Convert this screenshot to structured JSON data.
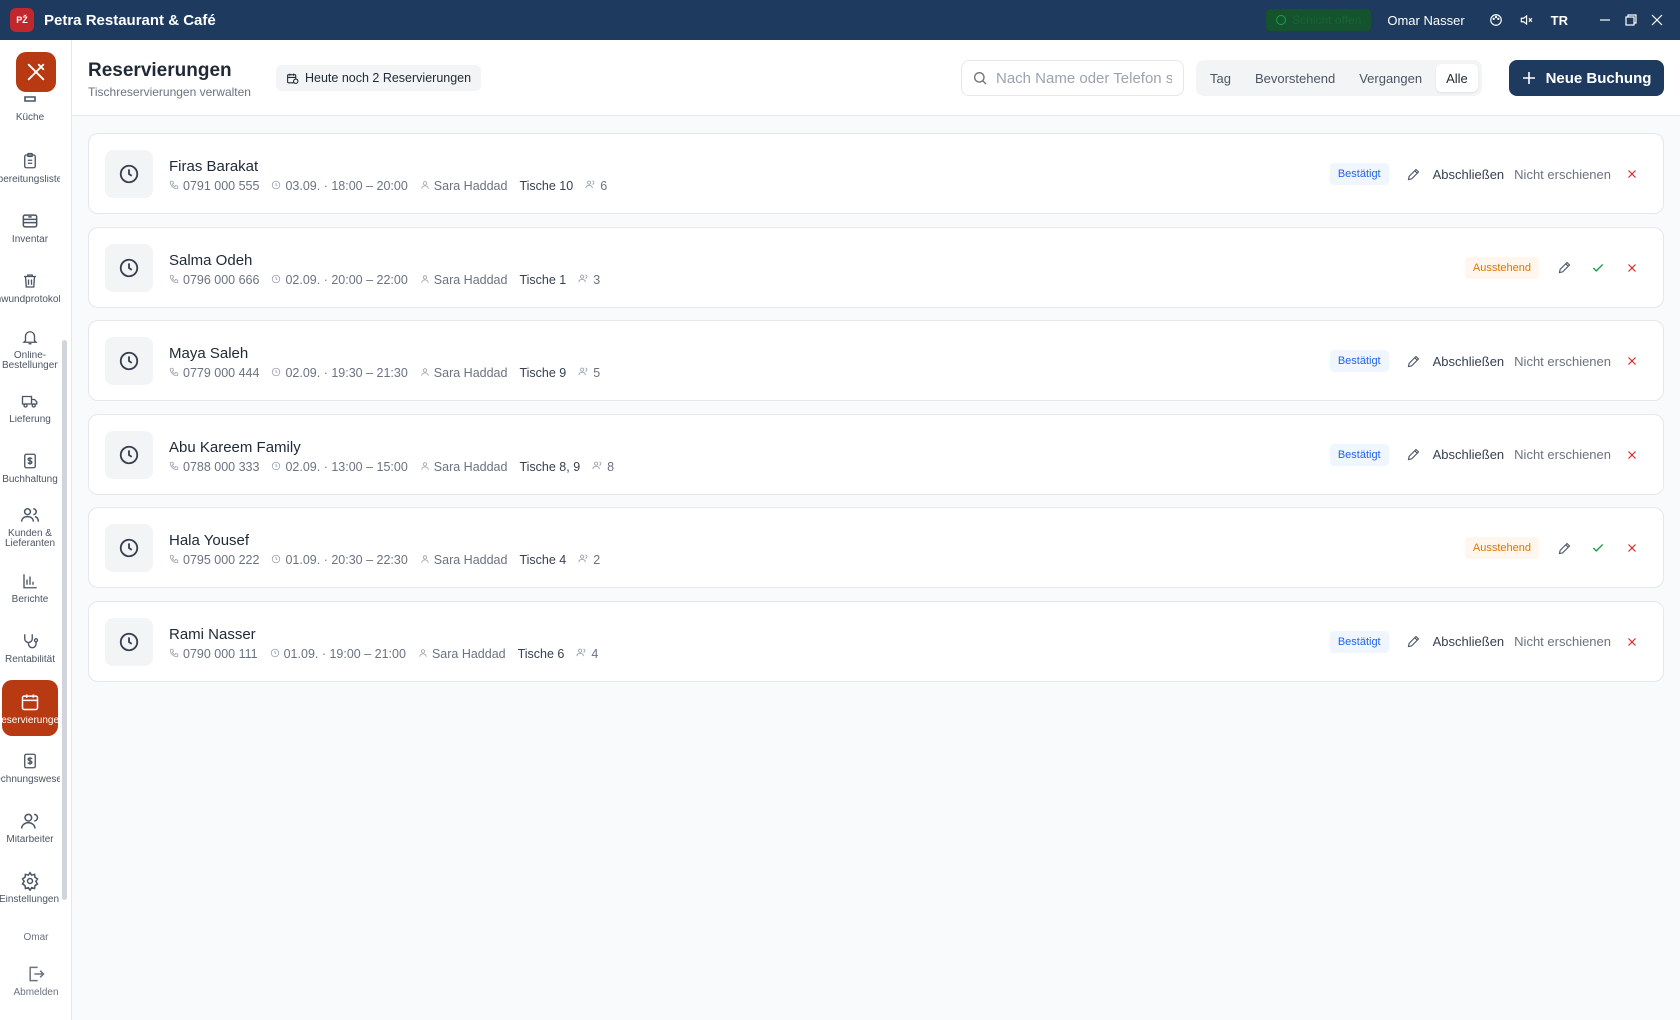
{
  "titlebar": {
    "logo_text": "PŽ",
    "app_title": "Petra Restaurant & Café",
    "shift_status": "Schicht offen",
    "user_name": "Omar Nasser",
    "language": "TR"
  },
  "sidebar": {
    "items": [
      {
        "label": "Küche",
        "icon": "chef-icon"
      },
      {
        "label": "Zubereitungsliste",
        "icon": "clipboard-icon"
      },
      {
        "label": "Inventar",
        "icon": "inventory-icon"
      },
      {
        "label": "Schwundprotokoll",
        "icon": "trash-icon"
      },
      {
        "label": "Online-Bestellungen",
        "icon": "bell-icon"
      },
      {
        "label": "Lieferung",
        "icon": "truck-icon"
      },
      {
        "label": "Buchhaltung",
        "icon": "dollar-doc-icon"
      },
      {
        "label": "Kunden & Lieferanten",
        "icon": "users-icon"
      },
      {
        "label": "Berichte",
        "icon": "bar-chart-icon"
      },
      {
        "label": "Rentabilität",
        "icon": "stethoscope-icon"
      },
      {
        "label": "Reservierungen",
        "icon": "calendar-icon"
      },
      {
        "label": "Rechnungswesen",
        "icon": "dollar-doc-icon"
      },
      {
        "label": "Mitarbeiter",
        "icon": "user-icon"
      },
      {
        "label": "Einstellungen",
        "icon": "gear-icon"
      }
    ],
    "user_short": "Omar",
    "logout_label": "Abmelden"
  },
  "header": {
    "title": "Reservierungen",
    "subtitle": "Tischreservierungen verwalten",
    "today_chip": "Heute noch 2 Reservierungen",
    "search_placeholder": "Nach Name oder Telefon s",
    "tabs": [
      "Tag",
      "Bevorstehend",
      "Vergangen",
      "Alle"
    ],
    "active_tab": "Alle",
    "new_booking_label": "Neue Buchung"
  },
  "labels": {
    "complete": "Abschließen",
    "no_show": "Nicht erschienen"
  },
  "colors": {
    "primary": "#1e3a5f",
    "accent": "#b83a12",
    "confirmed": "#2563eb",
    "pending": "#d97706",
    "danger": "#dc2626",
    "success": "#16a34a"
  },
  "reservations": [
    {
      "name": "Firas Barakat",
      "phone": "0791 000 555",
      "time": "03.09. · 18:00 – 20:00",
      "staff": "Sara Haddad",
      "tables": "Tische 10",
      "guests": "6",
      "status": "Bestätigt"
    },
    {
      "name": "Salma Odeh",
      "phone": "0796 000 666",
      "time": "02.09. · 20:00 – 22:00",
      "staff": "Sara Haddad",
      "tables": "Tische 1",
      "guests": "3",
      "status": "Ausstehend"
    },
    {
      "name": "Maya Saleh",
      "phone": "0779 000 444",
      "time": "02.09. · 19:30 – 21:30",
      "staff": "Sara Haddad",
      "tables": "Tische 9",
      "guests": "5",
      "status": "Bestätigt"
    },
    {
      "name": "Abu Kareem Family",
      "phone": "0788 000 333",
      "time": "02.09. · 13:00 – 15:00",
      "staff": "Sara Haddad",
      "tables": "Tische 8, 9",
      "guests": "8",
      "status": "Bestätigt"
    },
    {
      "name": "Hala Yousef",
      "phone": "0795 000 222",
      "time": "01.09. · 20:30 – 22:30",
      "staff": "Sara Haddad",
      "tables": "Tische 4",
      "guests": "2",
      "status": "Ausstehend"
    },
    {
      "name": "Rami Nasser",
      "phone": "0790 000 111",
      "time": "01.09. · 19:00 – 21:00",
      "staff": "Sara Haddad",
      "tables": "Tische 6",
      "guests": "4",
      "status": "Bestätigt"
    }
  ]
}
